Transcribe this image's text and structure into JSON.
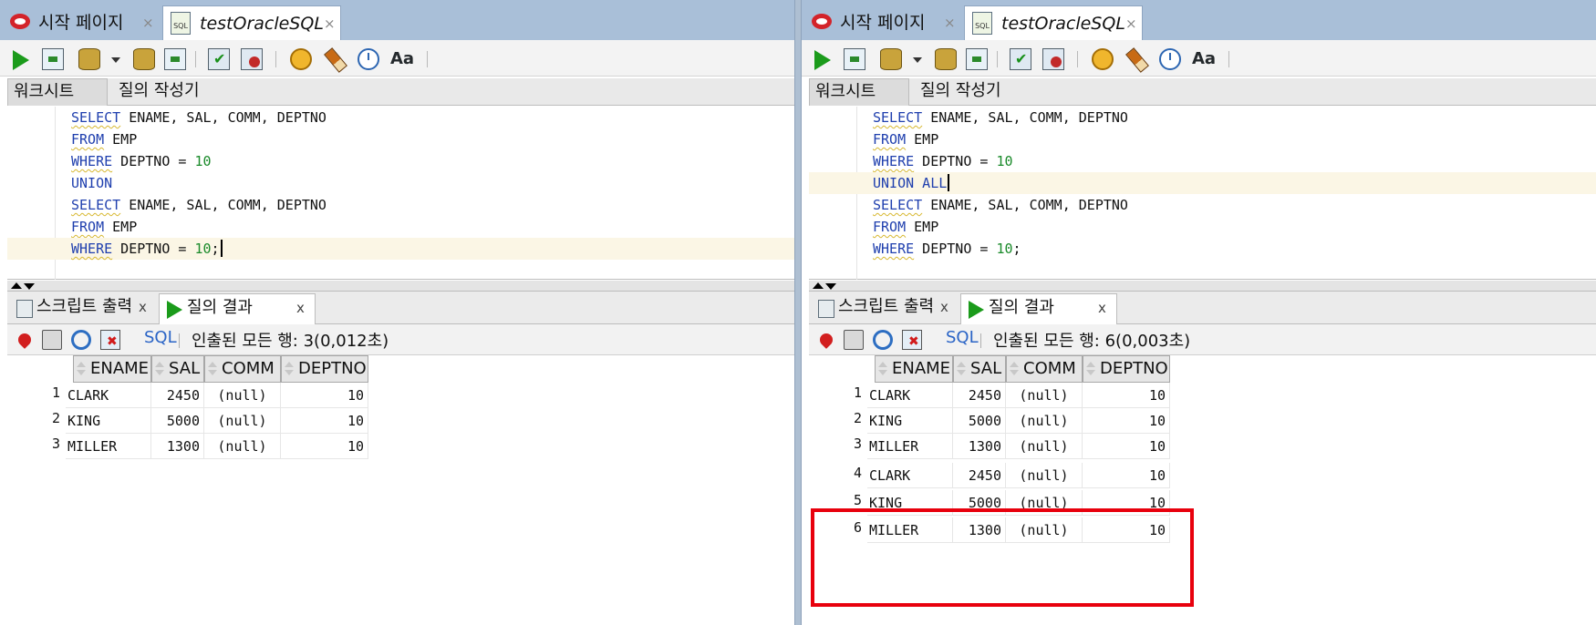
{
  "colors": {
    "keyword": "#1f3fae",
    "number": "#1a8a2a",
    "highlight_box": "#e8000d",
    "sql_link": "#2a64c6"
  },
  "panes": [
    {
      "doc_tabs": [
        {
          "label": "시작 페이지",
          "close": "×",
          "icon": "oracle-icon"
        },
        {
          "label": "testOracleSQL",
          "close": "×",
          "icon": "sql-file-icon"
        }
      ],
      "sub_tabs": [
        "워크시트",
        "질의 작성기"
      ],
      "code": {
        "line1_kw": "SELECT",
        "line1_rest": " ENAME, SAL, COMM, DEPTNO",
        "line2_kw": "FROM",
        "line2_rest": " EMP",
        "line3_kw": "WHERE",
        "line3_rest": " DEPTNO = ",
        "line3_num": "10",
        "line4_kw": "UNION",
        "line5_kw": "SELECT",
        "line5_rest": " ENAME, SAL, COMM, DEPTNO",
        "line6_kw": "FROM",
        "line6_rest": " EMP",
        "line7_kw": "WHERE",
        "line7_rest": " DEPTNO = ",
        "line7_num": "10",
        "line7_end": ";"
      },
      "output_tabs": [
        {
          "label": "스크립트 출력",
          "close": "x"
        },
        {
          "label": "질의 결과",
          "close": "x"
        }
      ],
      "result_toolbar": {
        "sql": "SQL",
        "status": "인출된 모든 행: 3(0,012초)"
      },
      "columns": [
        "ENAME",
        "SAL",
        "COMM",
        "DEPTNO"
      ],
      "rows": [
        {
          "n": "1",
          "ename": "CLARK",
          "sal": "2450",
          "comm": "(null)",
          "deptno": "10"
        },
        {
          "n": "2",
          "ename": "KING",
          "sal": "5000",
          "comm": "(null)",
          "deptno": "10"
        },
        {
          "n": "3",
          "ename": "MILLER",
          "sal": "1300",
          "comm": "(null)",
          "deptno": "10"
        }
      ]
    },
    {
      "doc_tabs": [
        {
          "label": "시작 페이지",
          "close": "×",
          "icon": "oracle-icon"
        },
        {
          "label": "testOracleSQL",
          "close": "×",
          "icon": "sql-file-icon"
        }
      ],
      "sub_tabs": [
        "워크시트",
        "질의 작성기"
      ],
      "code": {
        "line1_kw": "SELECT",
        "line1_rest": " ENAME, SAL, COMM, DEPTNO",
        "line2_kw": "FROM",
        "line2_rest": " EMP",
        "line3_kw": "WHERE",
        "line3_rest": " DEPTNO = ",
        "line3_num": "10",
        "line4_kw": "UNION ALL",
        "line5_kw": "SELECT",
        "line5_rest": " ENAME, SAL, COMM, DEPTNO",
        "line6_kw": "FROM",
        "line6_rest": " EMP",
        "line7_kw": "WHERE",
        "line7_rest": " DEPTNO = ",
        "line7_num": "10",
        "line7_end": ";"
      },
      "output_tabs": [
        {
          "label": "스크립트 출력",
          "close": "x"
        },
        {
          "label": "질의 결과",
          "close": "x"
        }
      ],
      "result_toolbar": {
        "sql": "SQL",
        "status": "인출된 모든 행: 6(0,003초)"
      },
      "columns": [
        "ENAME",
        "SAL",
        "COMM",
        "DEPTNO"
      ],
      "rows": [
        {
          "n": "1",
          "ename": "CLARK",
          "sal": "2450",
          "comm": "(null)",
          "deptno": "10"
        },
        {
          "n": "2",
          "ename": "KING",
          "sal": "5000",
          "comm": "(null)",
          "deptno": "10"
        },
        {
          "n": "3",
          "ename": "MILLER",
          "sal": "1300",
          "comm": "(null)",
          "deptno": "10"
        },
        {
          "n": "4",
          "ename": "CLARK",
          "sal": "2450",
          "comm": "(null)",
          "deptno": "10"
        },
        {
          "n": "5",
          "ename": "KING",
          "sal": "5000",
          "comm": "(null)",
          "deptno": "10"
        },
        {
          "n": "6",
          "ename": "MILLER",
          "sal": "1300",
          "comm": "(null)",
          "deptno": "10"
        }
      ]
    }
  ]
}
